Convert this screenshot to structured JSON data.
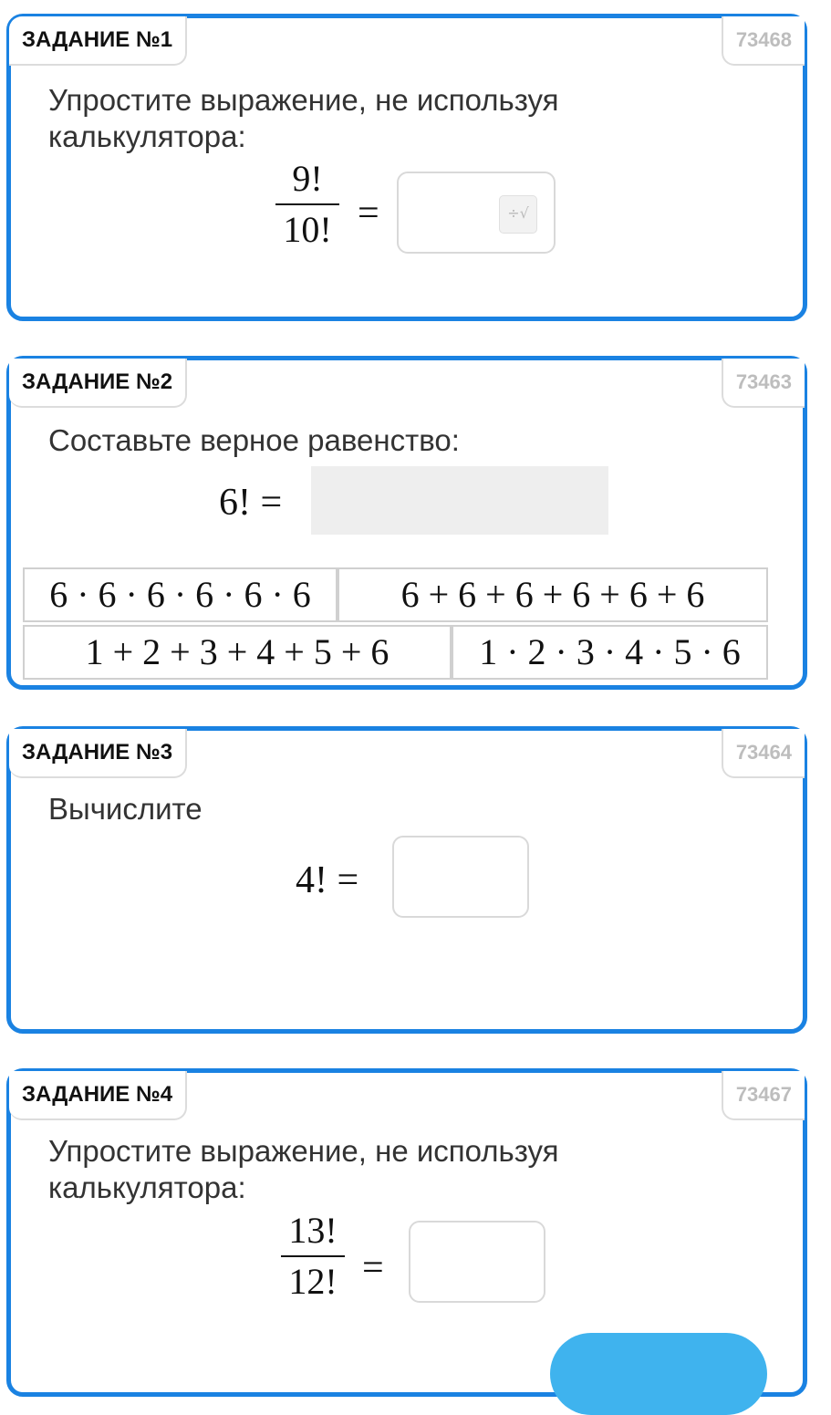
{
  "tasks": [
    {
      "label": "ЗАДАНИЕ №1",
      "id": "73468",
      "question": "Упростите выражение, не используя калькулятора:",
      "numerator": "9!",
      "denominator": "10!",
      "equals": "=",
      "answer_value": "",
      "has_calc_icon": true
    },
    {
      "label": "ЗАДАНИЕ №2",
      "id": "73463",
      "question": "Составьте верное равенство:",
      "lhs": "6! =",
      "options": [
        "6 · 6 · 6 · 6 · 6 · 6",
        "6 + 6 + 6 + 6 + 6 + 6",
        "1 + 2 + 3 + 4 + 5 + 6",
        "1 · 2 · 3 · 4 · 5 · 6"
      ]
    },
    {
      "label": "ЗАДАНИЕ №3",
      "id": "73464",
      "question": "Вычислите",
      "lhs": "4! =",
      "answer_value": ""
    },
    {
      "label": "ЗАДАНИЕ №4",
      "id": "73467",
      "question": "Упростите выражение, не используя калькулятора:",
      "numerator": "13!",
      "denominator": "12!",
      "equals": "=",
      "answer_value": ""
    }
  ],
  "colors": {
    "card_border": "#1a82e2",
    "button": "#3fb3ee",
    "id_text": "#bdbdbd"
  },
  "icons": [
    "calculator-icon"
  ]
}
